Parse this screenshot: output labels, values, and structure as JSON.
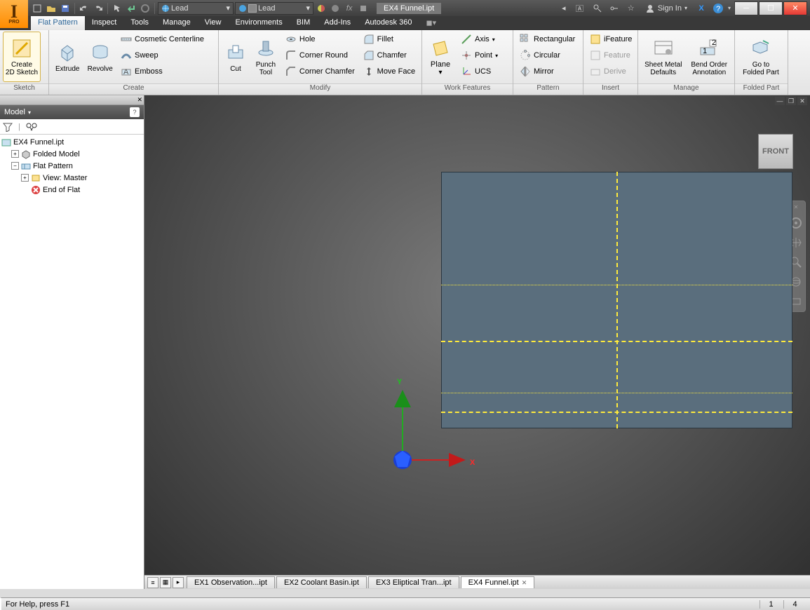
{
  "titlebar": {
    "material1": "Lead",
    "material2": "Lead",
    "doc_title": "EX4 Funnel.ipt",
    "signin": "Sign In"
  },
  "menus": {
    "tabs": [
      "Flat Pattern",
      "Inspect",
      "Tools",
      "Manage",
      "View",
      "Environments",
      "BIM",
      "Add-Ins",
      "Autodesk 360"
    ]
  },
  "ribbon": {
    "sketch": {
      "create2d": "Create\n2D Sketch",
      "label": "Sketch"
    },
    "create": {
      "extrude": "Extrude",
      "revolve": "Revolve",
      "cosmetic": "Cosmetic Centerline",
      "sweep": "Sweep",
      "emboss": "Emboss",
      "label": "Create"
    },
    "modify": {
      "cut": "Cut",
      "punch": "Punch\nTool",
      "hole": "Hole",
      "cornerround": "Corner Round",
      "cornerchamfer": "Corner Chamfer",
      "fillet": "Fillet",
      "chamfer": "Chamfer",
      "moveface": "Move Face",
      "label": "Modify"
    },
    "work": {
      "plane": "Plane",
      "axis": "Axis",
      "point": "Point",
      "ucs": "UCS",
      "label": "Work Features"
    },
    "pattern": {
      "rect": "Rectangular",
      "circ": "Circular",
      "mirror": "Mirror",
      "label": "Pattern"
    },
    "insert": {
      "ifeature": "iFeature",
      "feature": "Feature",
      "derive": "Derive",
      "label": "Insert"
    },
    "manage": {
      "smdefaults": "Sheet Metal\nDefaults",
      "bendorder": "Bend Order\nAnnotation",
      "label": "Manage"
    },
    "folded": {
      "goto": "Go to\nFolded Part",
      "label": "Folded Part"
    }
  },
  "browser": {
    "title": "Model",
    "root": "EX4 Funnel.ipt",
    "folded": "Folded Model",
    "flat": "Flat Pattern",
    "view": "View: Master",
    "eof": "End of Flat"
  },
  "viewcube": {
    "face": "FRONT"
  },
  "coord": {
    "x": "X",
    "y": "Y"
  },
  "doctabs": {
    "t1": "EX1 Observation...ipt",
    "t2": "EX2 Coolant Basin.ipt",
    "t3": "EX3 Eliptical Tran...ipt",
    "t4": "EX4 Funnel.ipt"
  },
  "status": {
    "help": "For Help, press F1",
    "n1": "1",
    "n2": "4"
  }
}
